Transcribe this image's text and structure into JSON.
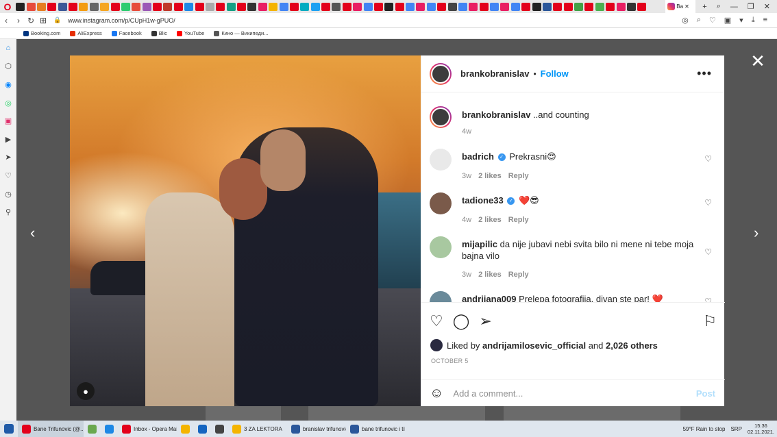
{
  "browser": {
    "active_tab_label": "Ba",
    "url": "www.instagram.com/p/CUpH1w-gPUO/",
    "bookmarks": [
      {
        "label": "Booking.com",
        "color": "#003580"
      },
      {
        "label": "AliExpress",
        "color": "#e62e04"
      },
      {
        "label": "Facebook",
        "color": "#1877f2"
      },
      {
        "label": "Blic",
        "color": "#333333"
      },
      {
        "label": "YouTube",
        "color": "#ff0000"
      },
      {
        "label": "Кино — Википеди...",
        "color": "#555555"
      }
    ],
    "sidebar_icons": [
      "home-icon",
      "speed-dial-icon",
      "messenger-icon",
      "whatsapp-icon",
      "instagram-icon",
      "player-icon",
      "send-icon",
      "heart-icon",
      "history-icon",
      "location-icon"
    ]
  },
  "post": {
    "author": "brankobranislav",
    "follow_label": "Follow",
    "more_label": "•••",
    "caption_author": "brankobranislav",
    "caption_text": "..and counting",
    "caption_age": "4w",
    "comments": [
      {
        "user": "badrich",
        "verified": true,
        "text": "Prekrasni😍",
        "age": "3w",
        "likes": "2 likes",
        "reply": "Reply",
        "avatar_color": "#e9e9e9"
      },
      {
        "user": "tadione33",
        "verified": true,
        "text": "❤️😎",
        "age": "4w",
        "likes": "2 likes",
        "reply": "Reply",
        "avatar_color": "#7a5a4a"
      },
      {
        "user": "mijapilic",
        "verified": false,
        "text": "da nije jubavi nebi svita bilo ni mene ni tebe moja bajna vilo",
        "age": "3w",
        "likes": "2 likes",
        "reply": "Reply",
        "avatar_color": "#a8c8a0"
      },
      {
        "user": "andrijana009",
        "verified": false,
        "text": "Prelepa fotografija, divan ste par! ❤️",
        "age": "",
        "likes": "",
        "reply": "",
        "avatar_color": "#6a8a9a"
      }
    ],
    "liked_by_prefix": "Liked by",
    "liked_by_user": "andrijamilosevic_official",
    "liked_by_and": "and",
    "liked_by_others": "2,026 others",
    "date": "OCTOBER 5",
    "comment_placeholder": "Add a comment...",
    "post_label": "Post"
  },
  "taskbar": {
    "items": [
      {
        "label": "Bane Trifunovic (@...",
        "color": "#e3001b"
      },
      {
        "label": "",
        "color": "#6aa84f"
      },
      {
        "label": "",
        "color": "#1e88e5"
      },
      {
        "label": "Inbox - Opera Mail",
        "color": "#e3001b"
      },
      {
        "label": "",
        "color": "#f4b400"
      },
      {
        "label": "",
        "color": "#1565c0"
      },
      {
        "label": "",
        "color": "#444444"
      },
      {
        "label": "3 ZA LEKTORA",
        "color": "#f4b400"
      },
      {
        "label": "branislav trifunovic...",
        "color": "#2b579a"
      },
      {
        "label": "bane trifunovic i tih...",
        "color": "#2b579a"
      }
    ],
    "weather": "59°F  Rain to stop",
    "language": "SRP",
    "time": "15:36",
    "date": "02.11.2021."
  }
}
